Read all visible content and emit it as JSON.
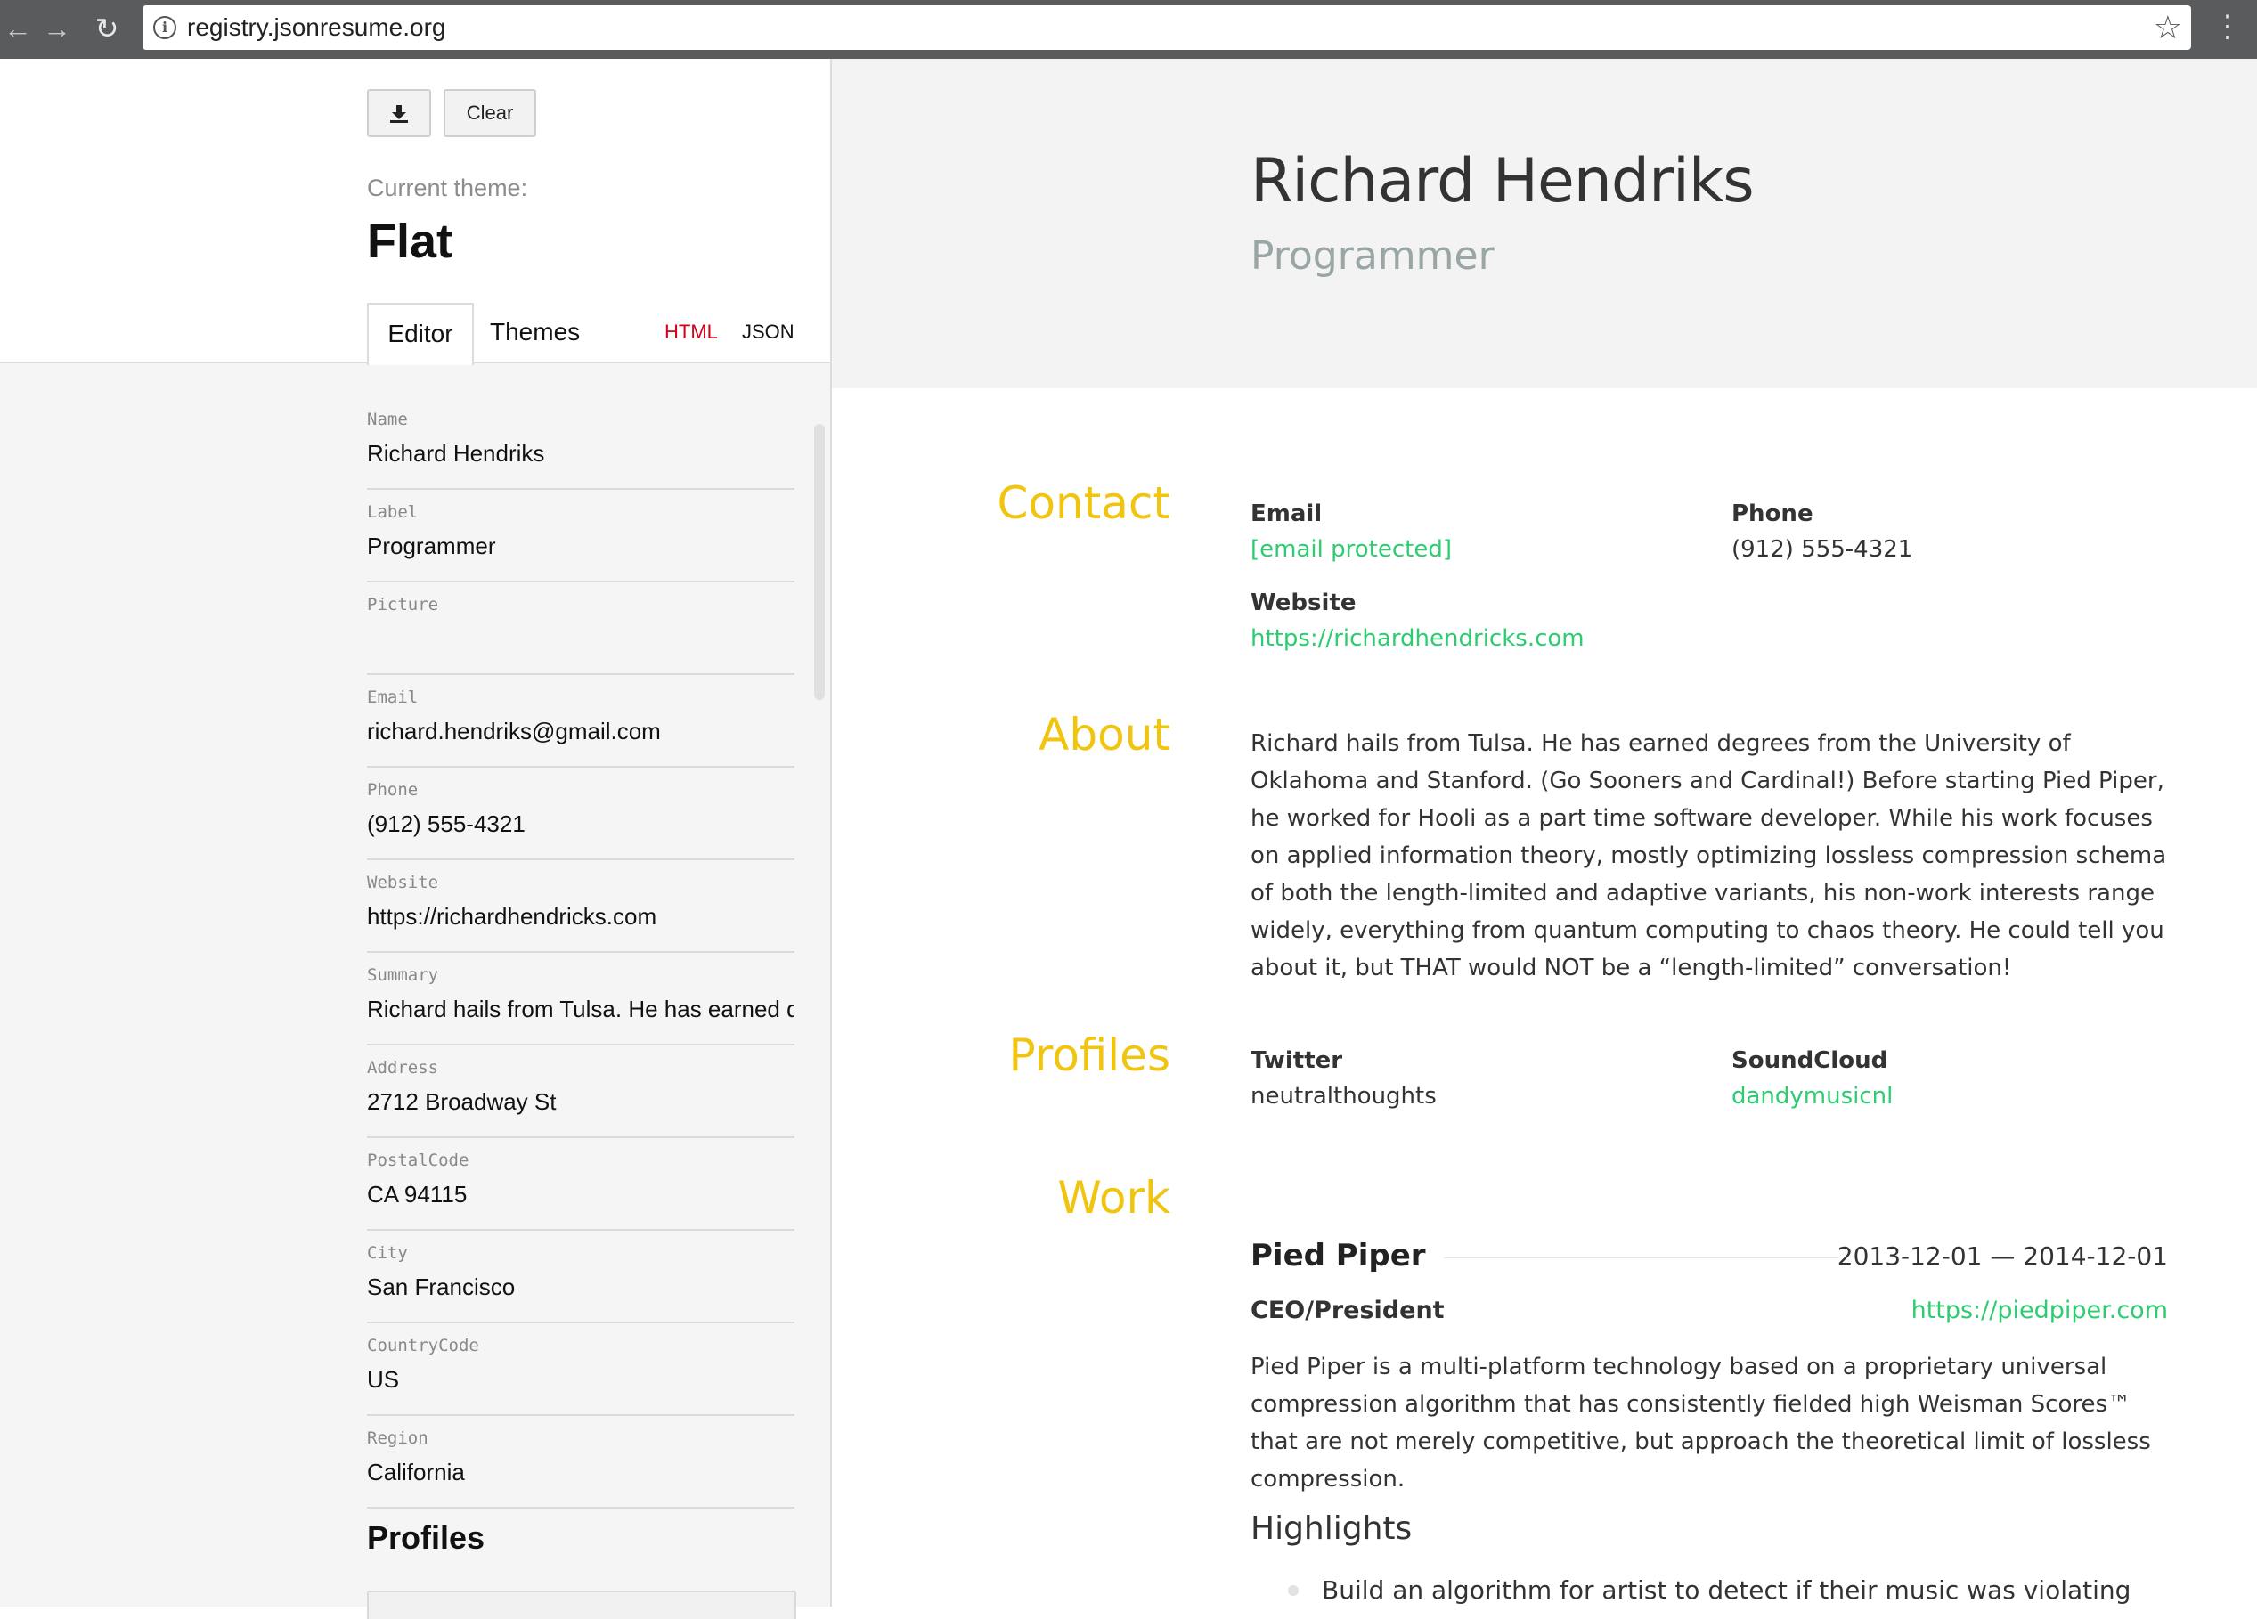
{
  "browser": {
    "url": "registry.jsonresume.org",
    "back_icon": "back-arrow-icon",
    "forward_icon": "forward-arrow-icon",
    "reload_icon": "reload-icon",
    "info_icon": "info-icon",
    "star_icon": "star-icon",
    "menu_icon": "menu-dots-icon"
  },
  "editor": {
    "download_icon": "download-icon",
    "clear_label": "Clear",
    "theme_caption": "Current theme:",
    "theme_name": "Flat",
    "tabs": {
      "editor": "Editor",
      "themes": "Themes",
      "html": "HTML",
      "json": "JSON"
    },
    "fields": [
      {
        "label": "Name",
        "value": "Richard Hendriks"
      },
      {
        "label": "Label",
        "value": "Programmer"
      },
      {
        "label": "Picture",
        "value": ""
      },
      {
        "label": "Email",
        "value": "richard.hendriks@gmail.com"
      },
      {
        "label": "Phone",
        "value": "(912) 555-4321"
      },
      {
        "label": "Website",
        "value": "https://richardhendricks.com"
      },
      {
        "label": "Summary",
        "value": "Richard hails from Tulsa. He has earned d"
      },
      {
        "label": "Address",
        "value": "2712 Broadway St"
      },
      {
        "label": "PostalCode",
        "value": "CA 94115"
      },
      {
        "label": "City",
        "value": "San Francisco"
      },
      {
        "label": "CountryCode",
        "value": "US"
      },
      {
        "label": "Region",
        "value": "California"
      }
    ],
    "profiles_heading": "Profiles"
  },
  "resume": {
    "name": "Richard Hendriks",
    "label": "Programmer",
    "sections": {
      "contact": "Contact",
      "about": "About",
      "profiles": "Profiles",
      "work": "Work"
    },
    "contact": {
      "email_label": "Email",
      "email_value": "[email protected]",
      "phone_label": "Phone",
      "phone_value": "(912) 555-4321",
      "website_label": "Website",
      "website_value": "https://richardhendricks.com"
    },
    "about": "Richard hails from Tulsa. He has earned degrees from the University of Oklahoma and Stanford. (Go Sooners and Cardinal!) Before starting Pied Piper, he worked for Hooli as a part time software developer. While his work focuses on applied information theory, mostly optimizing lossless compression schema of both the length-limited and adaptive variants, his non-work interests range widely, everything from quantum computing to chaos theory. He could tell you about it, but THAT would NOT be a “length-limited” conversation!",
    "profiles": [
      {
        "network": "Twitter",
        "username": "neutralthoughts"
      },
      {
        "network": "SoundCloud",
        "username": "dandymusicnl"
      }
    ],
    "work": {
      "company": "Pied Piper",
      "dates": "2013-12-01 — 2014-12-01",
      "position": "CEO/President",
      "website": "https://piedpiper.com",
      "summary": "Pied Piper is a multi-platform technology based on a proprietary universal compression algorithm that has consistently fielded high Weisman Scores™ that are not merely competitive, but approach the theoretical limit of lossless compression.",
      "highlights_heading": "Highlights",
      "highlights": [
        "Build an algorithm for artist to detect if their music was violating copy right infringement laws"
      ]
    }
  },
  "colors": {
    "accent_yellow": "#f1c40f",
    "link_green": "#2ecc71",
    "html_tab_red": "#d0021b"
  }
}
